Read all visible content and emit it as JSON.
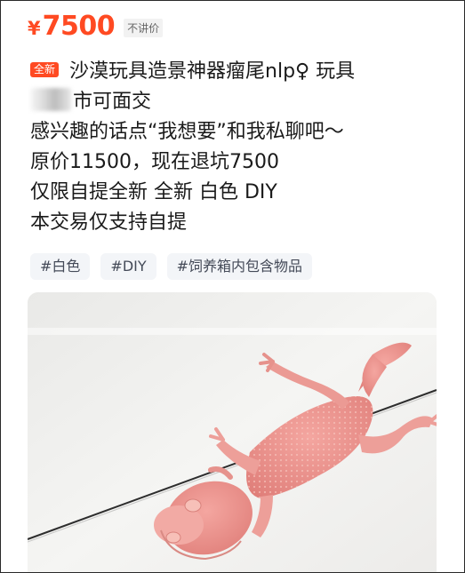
{
  "listing": {
    "price_symbol": "¥",
    "price": "7500",
    "price_note": "不讲价",
    "new_badge": "全新",
    "title_line_1": "沙漠玩具造景神器瘤尾nlp♀ 玩具",
    "title_line_2": "市可面交",
    "line_3": "感兴趣的话点“我想要”和我私聊吧～",
    "line_4": "原价11500，现在退坑7500",
    "line_5": "仅限自提全新 全新 白色 DIY",
    "line_6": "本交易仅支持自提",
    "tags": [
      "#白色",
      "#DIY",
      "#饲养箱内包含物品"
    ]
  },
  "colors": {
    "accent": "#ff4a22",
    "tag_background": "#f3f5f8"
  },
  "photo": {
    "subject": "pink gecko lying on a light surface"
  }
}
